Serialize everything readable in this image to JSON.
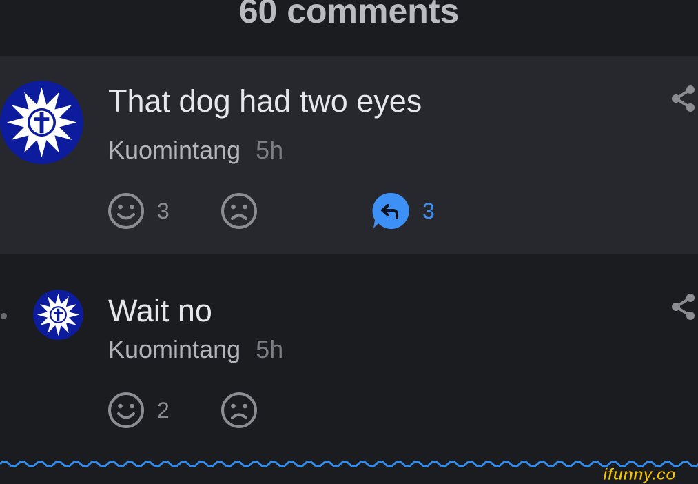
{
  "header": {
    "title": "60 comments"
  },
  "comments": [
    {
      "text": "That dog had two eyes",
      "author": "Kuomintang",
      "time": "5h",
      "likes": "3",
      "replies": "3"
    },
    {
      "text": "Wait no",
      "author": "Kuomintang",
      "time": "5h",
      "likes": "2"
    }
  ],
  "colors": {
    "accent": "#3d90f5",
    "background": "#1b1c20",
    "highlight_background": "#27282d",
    "avatar_blue": "#0c1c9c"
  },
  "icons": [
    "smile-icon",
    "frown-icon",
    "reply-icon",
    "share-icon",
    "avatar-emblem"
  ],
  "watermark": "ifunny.co"
}
